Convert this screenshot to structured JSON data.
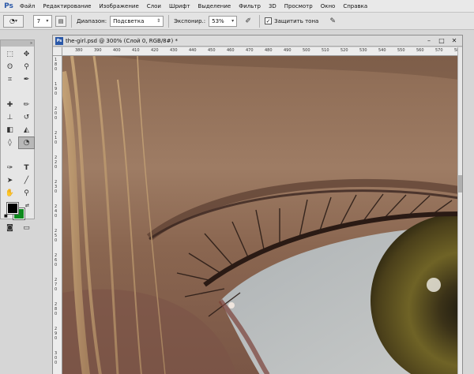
{
  "menubar": {
    "logo": "Ps",
    "items": [
      "Файл",
      "Редактирование",
      "Изображение",
      "Слои",
      "Шрифт",
      "Выделение",
      "Фильтр",
      "3D",
      "Просмотр",
      "Окно",
      "Справка"
    ]
  },
  "options": {
    "brush_size": "7",
    "range_label": "Диапазон:",
    "range_value": "Подсветка",
    "exposure_label": "Экспонир.:",
    "exposure_value": "53%",
    "protect_label": "Защитить тона",
    "protect_checked": "✓"
  },
  "document": {
    "title": "the-girl.psd @ 300% (Слой 0, RGB/8#) *",
    "ruler_h": [
      "380",
      "390",
      "400",
      "410",
      "420",
      "430",
      "440",
      "450",
      "460",
      "470",
      "480",
      "490",
      "500",
      "510",
      "520",
      "530",
      "540",
      "550",
      "560",
      "570",
      "580",
      "590"
    ],
    "ruler_v": [
      "1 8 0",
      "1 9 0",
      "2 0 0",
      "2 1 0",
      "2 2 0",
      "2 3 0",
      "2 4 0",
      "2 5 0",
      "2 6 0",
      "2 7 0",
      "2 8 0",
      "2 9 0",
      "3 0 0"
    ]
  },
  "colors": {
    "foreground": "#000000",
    "background": "#0d8a1d",
    "accent": "#2a58a8"
  }
}
